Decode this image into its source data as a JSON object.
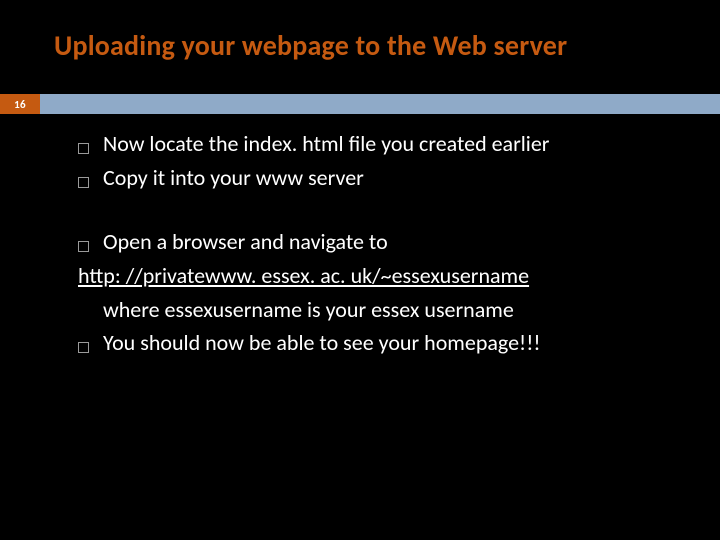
{
  "slide": {
    "title": "Uploading your webpage to the Web server",
    "page_number": "16",
    "bullets_group1": [
      "Now locate the index. html file you created earlier",
      "Copy it into your www server"
    ],
    "bullet_open": "Open a browser and navigate to",
    "link": "http: //privatewww. essex. ac. uk/~essexusername",
    "sub_line": "where essexusername is your essex username",
    "bullet_final": "You should now be able to see your homepage!!!"
  }
}
